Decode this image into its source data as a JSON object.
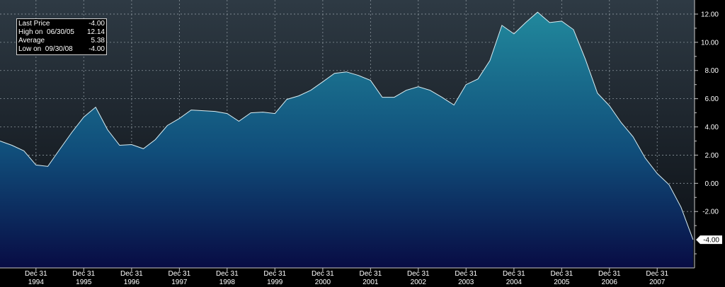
{
  "chart_data": {
    "type": "area",
    "y_axis_position": "right",
    "ylim": [
      -6,
      13
    ],
    "y_ticks": [
      {
        "value": 12,
        "label": "12.00"
      },
      {
        "value": 10,
        "label": "10.00"
      },
      {
        "value": 8,
        "label": "8.00"
      },
      {
        "value": 6,
        "label": "6.00"
      },
      {
        "value": 4,
        "label": "4.00"
      },
      {
        "value": 2,
        "label": "2.00"
      },
      {
        "value": 0,
        "label": "0.00"
      },
      {
        "value": -2,
        "label": "-2.00"
      }
    ],
    "x_ticks": [
      {
        "date": "1994-12-31",
        "label_top": "Dec 31",
        "label_bottom": "1994"
      },
      {
        "date": "1995-12-31",
        "label_top": "Dec 31",
        "label_bottom": "1995"
      },
      {
        "date": "1996-12-31",
        "label_top": "Dec 31",
        "label_bottom": "1996"
      },
      {
        "date": "1997-12-31",
        "label_top": "Dec 31",
        "label_bottom": "1997"
      },
      {
        "date": "1998-12-31",
        "label_top": "Dec 31",
        "label_bottom": "1998"
      },
      {
        "date": "1999-12-31",
        "label_top": "Dec 31",
        "label_bottom": "1999"
      },
      {
        "date": "2000-12-31",
        "label_top": "Dec 31",
        "label_bottom": "2000"
      },
      {
        "date": "2001-12-31",
        "label_top": "Dec 31",
        "label_bottom": "2001"
      },
      {
        "date": "2002-12-31",
        "label_top": "Dec 31",
        "label_bottom": "2002"
      },
      {
        "date": "2003-12-31",
        "label_top": "Dec 31",
        "label_bottom": "2003"
      },
      {
        "date": "2004-12-31",
        "label_top": "Dec 31",
        "label_bottom": "2004"
      },
      {
        "date": "2005-12-31",
        "label_top": "Dec 31",
        "label_bottom": "2005"
      },
      {
        "date": "2006-12-31",
        "label_top": "Dec 31",
        "label_bottom": "2006"
      },
      {
        "date": "2007-12-31",
        "label_top": "Dec 31",
        "label_bottom": "2007"
      }
    ],
    "x_range": [
      "1994-03-31",
      "2009-03-31"
    ],
    "grid": true,
    "last_value_label": "-4.00",
    "stats": [
      {
        "label": "Last Price",
        "value": "-4.00"
      },
      {
        "label": "High on  06/30/05",
        "value": "12.14"
      },
      {
        "label": "Average",
        "value": "5.38"
      },
      {
        "label": "Low on  09/30/08",
        "value": "-4.00"
      }
    ],
    "series": [
      {
        "points": [
          [
            "1994-03-31",
            3.0
          ],
          [
            "1994-06-30",
            2.7
          ],
          [
            "1994-09-30",
            2.3
          ],
          [
            "1994-12-31",
            1.3
          ],
          [
            "1995-03-31",
            1.2
          ],
          [
            "1995-06-30",
            2.4
          ],
          [
            "1995-09-30",
            3.6
          ],
          [
            "1995-12-31",
            4.7
          ],
          [
            "1996-03-31",
            5.4
          ],
          [
            "1996-06-30",
            3.8
          ],
          [
            "1996-09-30",
            2.7
          ],
          [
            "1996-12-31",
            2.75
          ],
          [
            "1997-03-31",
            2.45
          ],
          [
            "1997-06-30",
            3.1
          ],
          [
            "1997-09-30",
            4.1
          ],
          [
            "1997-12-31",
            4.6
          ],
          [
            "1998-03-31",
            5.2
          ],
          [
            "1998-06-30",
            5.15
          ],
          [
            "1998-09-30",
            5.1
          ],
          [
            "1998-12-31",
            4.95
          ],
          [
            "1999-03-31",
            4.4
          ],
          [
            "1999-06-30",
            5.0
          ],
          [
            "1999-09-30",
            5.05
          ],
          [
            "1999-12-31",
            4.95
          ],
          [
            "2000-03-31",
            5.95
          ],
          [
            "2000-06-30",
            6.2
          ],
          [
            "2000-09-30",
            6.6
          ],
          [
            "2000-12-31",
            7.2
          ],
          [
            "2001-03-31",
            7.8
          ],
          [
            "2001-06-30",
            7.9
          ],
          [
            "2001-09-30",
            7.65
          ],
          [
            "2001-12-31",
            7.3
          ],
          [
            "2002-03-31",
            6.1
          ],
          [
            "2002-06-30",
            6.1
          ],
          [
            "2002-09-30",
            6.6
          ],
          [
            "2002-12-31",
            6.85
          ],
          [
            "2003-03-31",
            6.6
          ],
          [
            "2003-06-30",
            6.1
          ],
          [
            "2003-09-30",
            5.55
          ],
          [
            "2003-12-31",
            7.0
          ],
          [
            "2004-03-31",
            7.4
          ],
          [
            "2004-06-30",
            8.7
          ],
          [
            "2004-09-30",
            11.2
          ],
          [
            "2004-12-31",
            10.6
          ],
          [
            "2005-03-31",
            11.4
          ],
          [
            "2005-06-30",
            12.14
          ],
          [
            "2005-09-30",
            11.4
          ],
          [
            "2005-12-31",
            11.5
          ],
          [
            "2006-03-31",
            10.9
          ],
          [
            "2006-06-30",
            8.8
          ],
          [
            "2006-09-30",
            6.4
          ],
          [
            "2006-12-31",
            5.5
          ],
          [
            "2007-03-31",
            4.3
          ],
          [
            "2007-06-30",
            3.3
          ],
          [
            "2007-09-30",
            1.8
          ],
          [
            "2007-12-31",
            0.7
          ],
          [
            "2008-03-31",
            -0.1
          ],
          [
            "2008-06-30",
            -1.7
          ],
          [
            "2008-09-30",
            -4.0
          ]
        ]
      }
    ]
  }
}
